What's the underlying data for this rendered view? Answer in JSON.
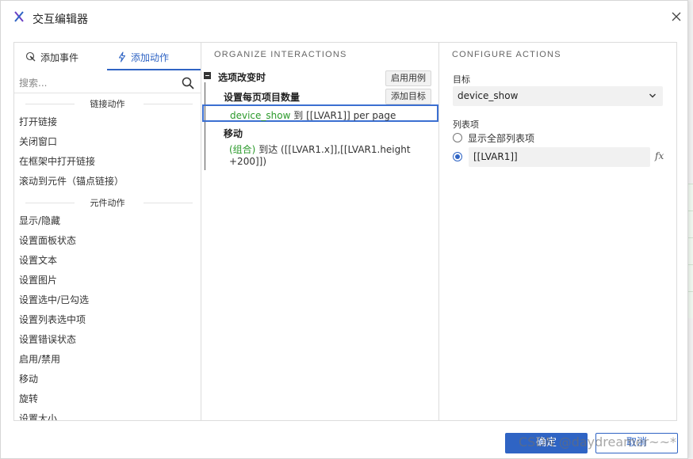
{
  "window": {
    "title": "交互编辑器"
  },
  "left_panel": {
    "tabs": [
      {
        "label": "添加事件",
        "icon": "cursor-click-icon",
        "active": false
      },
      {
        "label": "添加动作",
        "icon": "lightning-icon",
        "active": true
      }
    ],
    "search": {
      "placeholder": "搜索...",
      "value": ""
    },
    "groups": [
      {
        "heading": "链接动作",
        "items": [
          "打开链接",
          "关闭窗口",
          "在框架中打开链接",
          "滚动到元件（锚点链接）"
        ]
      },
      {
        "heading": "元件动作",
        "items": [
          "显示/隐藏",
          "设置面板状态",
          "设置文本",
          "设置图片",
          "设置选中/已勾选",
          "设置列表选中项",
          "设置错误状态",
          "启用/禁用",
          "移动",
          "旋转",
          "设置大小"
        ]
      }
    ]
  },
  "middle_panel": {
    "heading": "ORGANIZE INTERACTIONS",
    "event": {
      "title": "选项改变时",
      "enable_case_label": "启用用例"
    },
    "actions": [
      {
        "title": "设置每页项目数量",
        "add_target_label": "添加目标",
        "target": "device_show",
        "detail": "到 [[LVAR1]] per page",
        "selected": true
      },
      {
        "title": "移动",
        "target": "(组合)",
        "detail": "到达 ([[LVAR1.x]],[[LVAR1.height +200]])"
      }
    ]
  },
  "right_panel": {
    "heading": "CONFIGURE ACTIONS",
    "target_label": "目标",
    "target_value": "device_show",
    "list_label": "列表项",
    "options": [
      {
        "label": "显示全部列表项",
        "selected": false
      },
      {
        "label": "[[LVAR1]]",
        "selected": true
      }
    ],
    "fx_label": "fx"
  },
  "footer": {
    "ok_label": "确定",
    "cancel_label": "取消"
  },
  "watermark": "CSDN @daydreamer~~*",
  "colors": {
    "accent": "#2f64c4",
    "target_green": "#2b9a2b",
    "selection_border": "#3b6fd1"
  }
}
